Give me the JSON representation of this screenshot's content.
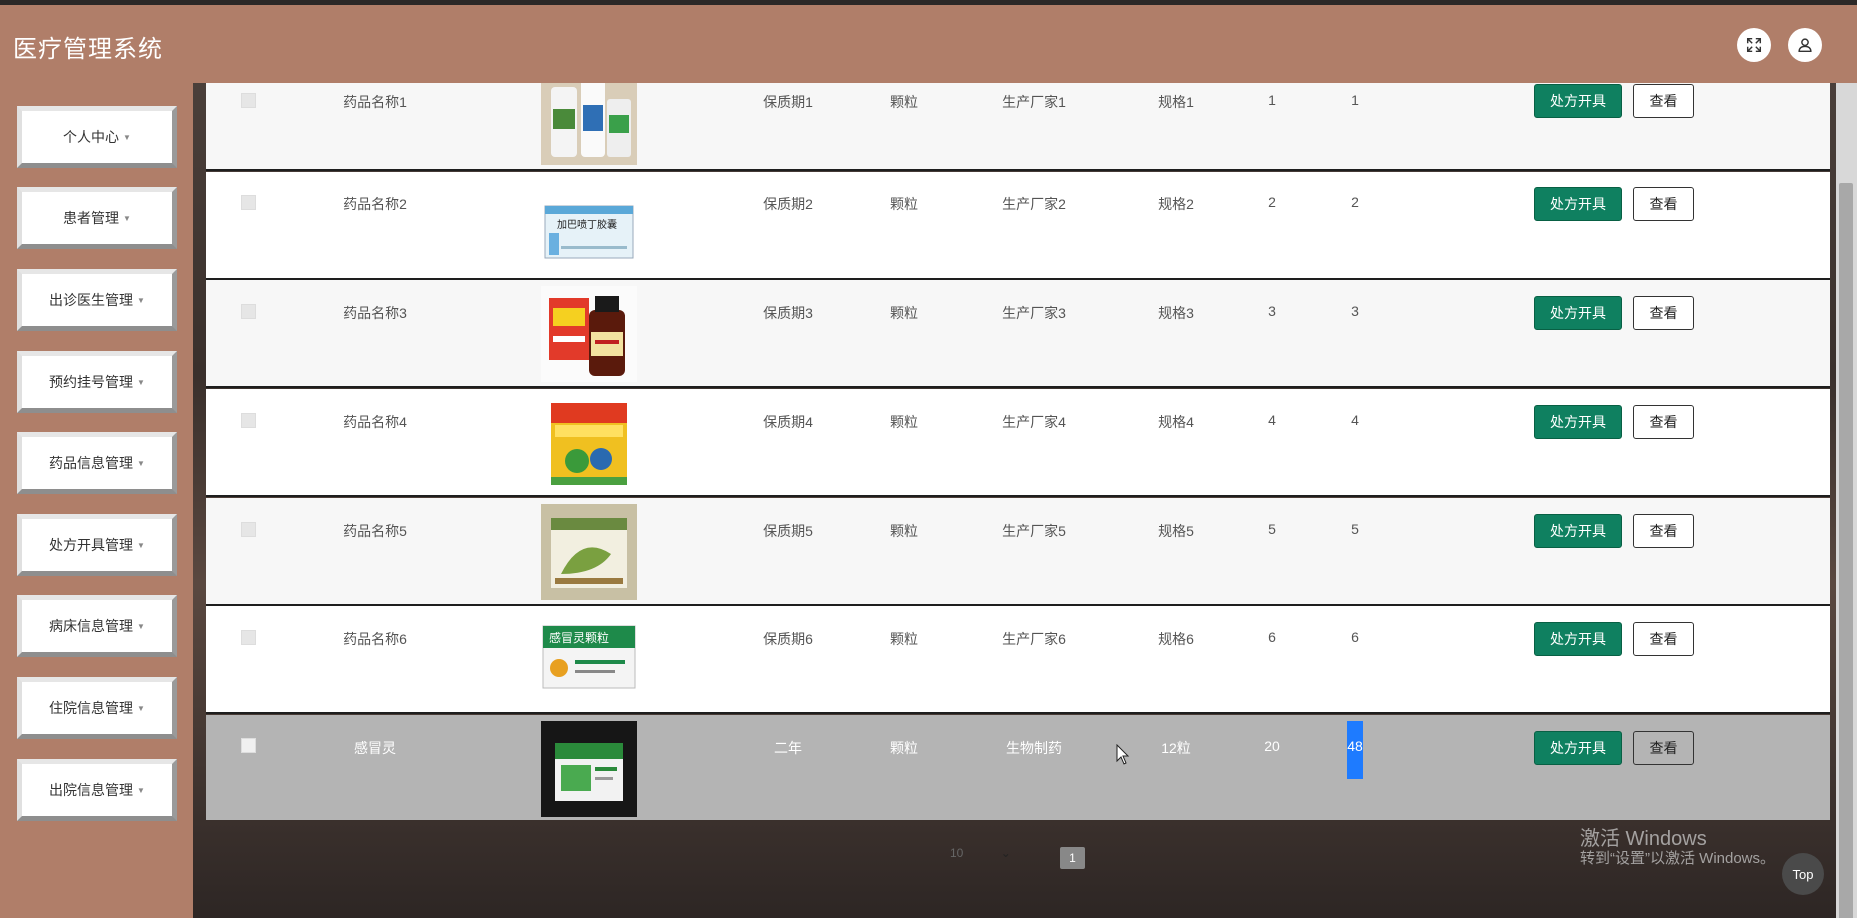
{
  "app": {
    "title": "医疗管理系统"
  },
  "topbar": {
    "fullscreen_icon": "expand-icon",
    "user_icon": "user-icon"
  },
  "sidebar": {
    "items": [
      {
        "label": "个人中心"
      },
      {
        "label": "患者管理"
      },
      {
        "label": "出诊医生管理"
      },
      {
        "label": "预约挂号管理"
      },
      {
        "label": "药品信息管理"
      },
      {
        "label": "处方开具管理"
      },
      {
        "label": "病床信息管理"
      },
      {
        "label": "住院信息管理"
      },
      {
        "label": "出院信息管理"
      }
    ]
  },
  "table": {
    "rows": [
      {
        "name": "药品名称1",
        "shelf": "保质期1",
        "form": "颗粒",
        "maker": "生产厂家1",
        "spec": "规格1",
        "qty": "1",
        "price": "1",
        "image": "medicine-bottles"
      },
      {
        "name": "药品名称2",
        "shelf": "保质期2",
        "form": "颗粒",
        "maker": "生产厂家2",
        "spec": "规格2",
        "qty": "2",
        "price": "2",
        "image": "capsule-box",
        "image_text": "加巴喷丁胶囊"
      },
      {
        "name": "药品名称3",
        "shelf": "保质期3",
        "form": "颗粒",
        "maker": "生产厂家3",
        "spec": "规格3",
        "qty": "3",
        "price": "3",
        "image": "syrup-bottle"
      },
      {
        "name": "药品名称4",
        "shelf": "保质期4",
        "form": "颗粒",
        "maker": "生产厂家4",
        "spec": "规格4",
        "qty": "4",
        "price": "4",
        "image": "granule-box"
      },
      {
        "name": "药品名称5",
        "shelf": "保质期5",
        "form": "颗粒",
        "maker": "生产厂家5",
        "spec": "规格5",
        "qty": "5",
        "price": "5",
        "image": "green-box"
      },
      {
        "name": "药品名称6",
        "shelf": "保质期6",
        "form": "颗粒",
        "maker": "生产厂家6",
        "spec": "规格6",
        "qty": "6",
        "price": "6",
        "image": "cold-granule-box",
        "image_text": "感冒灵颗粒"
      },
      {
        "name": "感冒灵",
        "shelf": "二年",
        "form": "颗粒",
        "maker": "生物制药",
        "spec": "12粒",
        "qty": "20",
        "price": "48",
        "image": "green-medicine-box"
      }
    ],
    "actions": {
      "prescribe": "处方开具",
      "view": "查看"
    }
  },
  "pagination": {
    "page_size": "10",
    "current_page": "1"
  },
  "watermark": {
    "title": "激活 Windows",
    "subtitle": "转到“设置”以激活 Windows。"
  },
  "back_to_top": "Top",
  "colors": {
    "header": "#b07e69",
    "primary_button": "#0f8060",
    "selected_row": "#b4b4b4"
  }
}
